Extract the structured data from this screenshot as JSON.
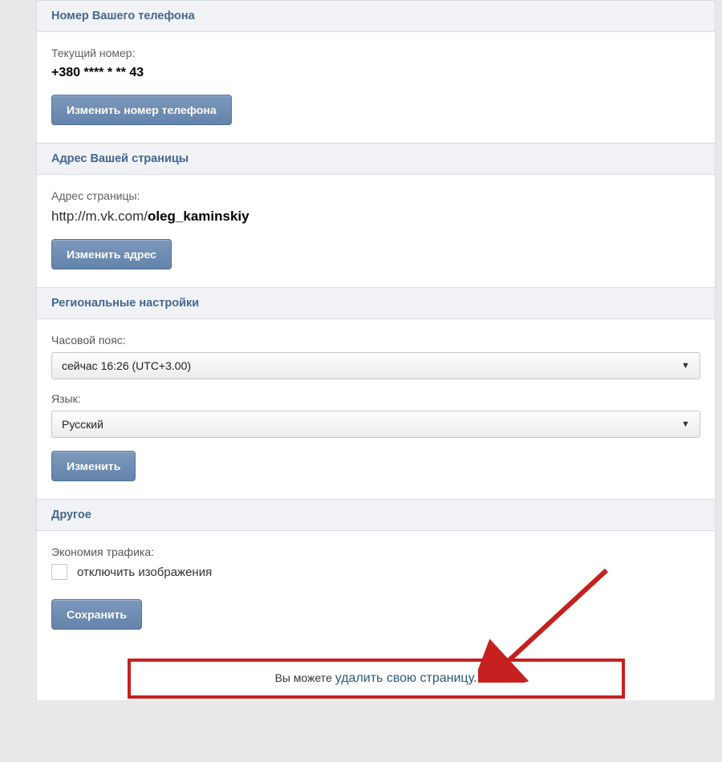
{
  "phone": {
    "header": "Номер Вашего телефона",
    "current_label": "Текущий номер:",
    "current_value": "+380 **** * ** 43",
    "change_button": "Изменить номер телефона"
  },
  "address": {
    "header": "Адрес Вашей страницы",
    "label": "Адрес страницы:",
    "url_prefix": "http://m.vk.com/",
    "url_suffix": "oleg_kaminskiy",
    "change_button": "Изменить адрес"
  },
  "regional": {
    "header": "Региональные настройки",
    "timezone_label": "Часовой пояс:",
    "timezone_value": "сейчас 16:26 (UTC+3.00)",
    "language_label": "Язык:",
    "language_value": "Русский",
    "change_button": "Изменить"
  },
  "other": {
    "header": "Другое",
    "traffic_label": "Экономия трафика:",
    "disable_images_label": "отключить изображения",
    "save_button": "Сохранить"
  },
  "delete": {
    "prefix": "Вы можете ",
    "link": "удалить свою страницу."
  }
}
